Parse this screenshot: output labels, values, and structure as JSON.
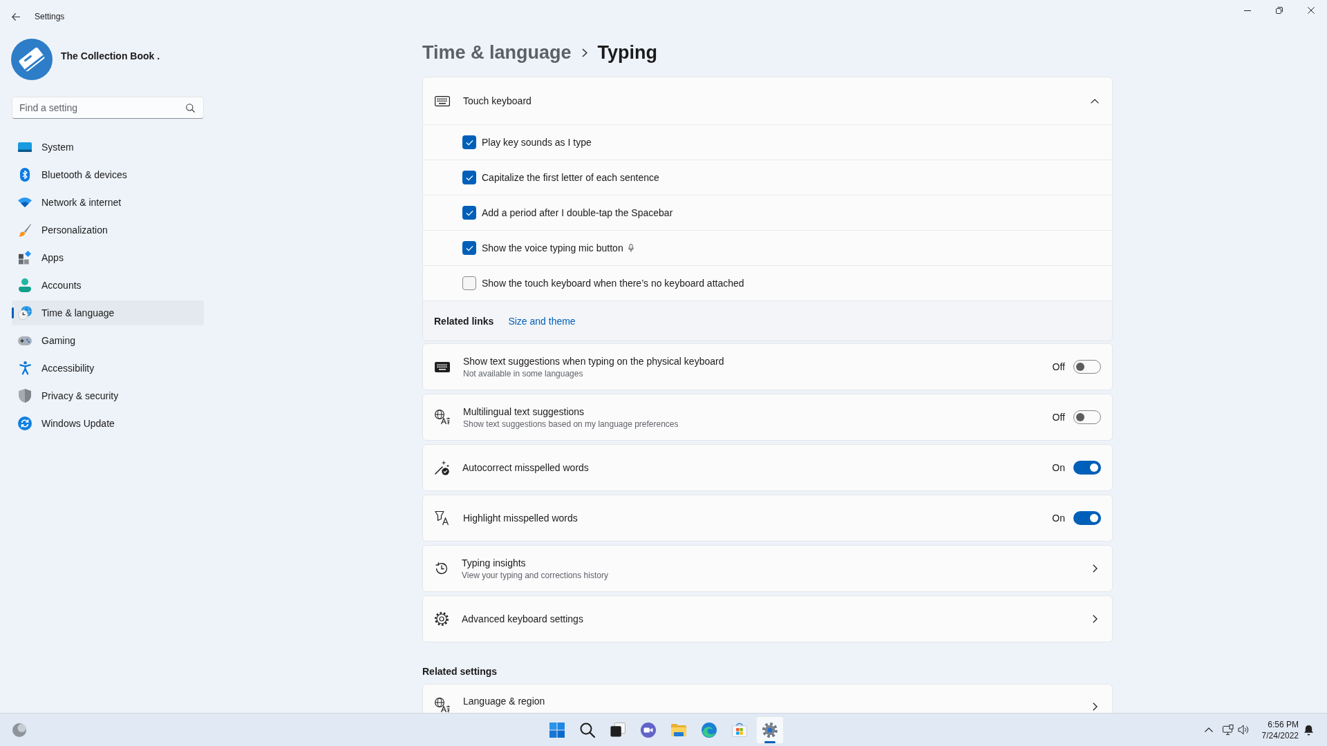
{
  "window": {
    "title": "Settings"
  },
  "account": {
    "name": "The Collection Book ."
  },
  "search": {
    "placeholder": "Find a setting"
  },
  "nav": [
    {
      "label": "System",
      "selected": false
    },
    {
      "label": "Bluetooth & devices",
      "selected": false
    },
    {
      "label": "Network & internet",
      "selected": false
    },
    {
      "label": "Personalization",
      "selected": false
    },
    {
      "label": "Apps",
      "selected": false
    },
    {
      "label": "Accounts",
      "selected": false
    },
    {
      "label": "Time & language",
      "selected": true
    },
    {
      "label": "Gaming",
      "selected": false
    },
    {
      "label": "Accessibility",
      "selected": false
    },
    {
      "label": "Privacy & security",
      "selected": false
    },
    {
      "label": "Windows Update",
      "selected": false
    }
  ],
  "breadcrumb": [
    "Time & language",
    "Typing"
  ],
  "touch_keyboard": {
    "title": "Touch keyboard",
    "expanded": true,
    "options": [
      {
        "kind": "plain",
        "label": "Play key sounds as I type",
        "checked": true
      },
      {
        "kind": "plain",
        "label": "Capitalize the first letter of each sentence",
        "checked": true
      },
      {
        "kind": "plain",
        "label": "Add a period after I double-tap the Spacebar",
        "checked": true
      },
      {
        "kind": "mic",
        "label": "Show the voice typing mic button",
        "checked": true
      },
      {
        "kind": "plain",
        "label": "Show the touch keyboard when there’s no keyboard attached",
        "checked": false
      }
    ],
    "related_links": {
      "label": "Related links",
      "links": [
        "Size and theme"
      ]
    }
  },
  "settings": [
    {
      "kind": "toggle",
      "title": "Show text suggestions when typing on the physical keyboard",
      "subtitle": "Not available in some languages",
      "state_label": "Off",
      "on": false
    },
    {
      "kind": "toggle",
      "title": "Multilingual text suggestions",
      "subtitle": "Show text suggestions based on my language preferences",
      "state_label": "Off",
      "on": false
    },
    {
      "kind": "toggle",
      "title": "Autocorrect misspelled words",
      "state_label": "On",
      "on": true
    },
    {
      "kind": "toggle",
      "title": "Highlight misspelled words",
      "state_label": "On",
      "on": true
    },
    {
      "kind": "link",
      "title": "Typing insights",
      "subtitle": "View your typing and corrections history"
    },
    {
      "kind": "link",
      "title": "Advanced keyboard settings"
    }
  ],
  "related_settings": {
    "heading": "Related settings",
    "items": [
      {
        "kind": "link",
        "title": "Language & region"
      }
    ]
  },
  "taskbar": {
    "apps": [
      {
        "selected": false
      },
      {
        "selected": false
      },
      {
        "selected": false
      },
      {
        "selected": false
      },
      {
        "selected": false
      },
      {
        "selected": false
      },
      {
        "selected": false
      },
      {
        "selected": true
      }
    ],
    "clock": {
      "time": "6:56 PM",
      "date": "7/24/2022"
    }
  }
}
